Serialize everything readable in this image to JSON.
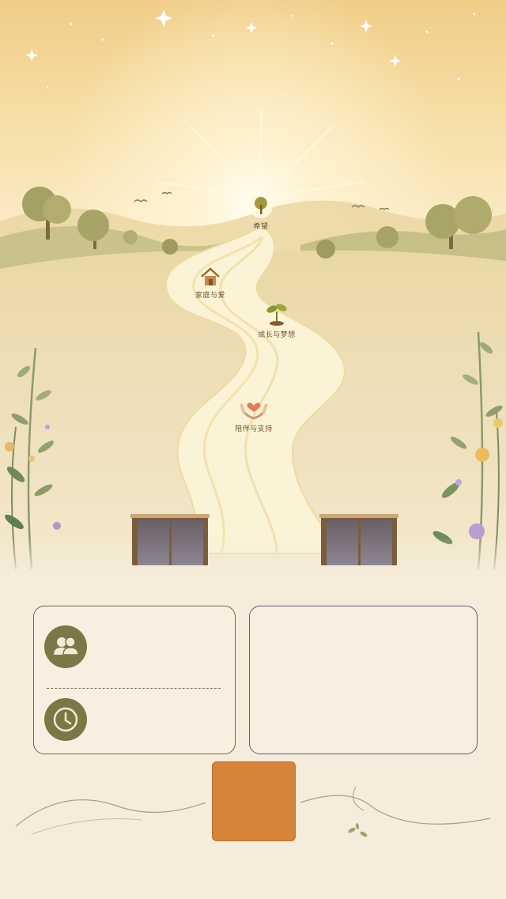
{
  "scene": {
    "milestones": [
      {
        "id": "tree",
        "icon": "tree-icon",
        "label": "希望"
      },
      {
        "id": "home",
        "icon": "house-icon",
        "label": "家庭与爱"
      },
      {
        "id": "sprout",
        "icon": "sprout-icon",
        "label": "成长与梦想"
      },
      {
        "id": "hands",
        "icon": "heart-hands-icon",
        "label": "陪伴与支持"
      }
    ]
  },
  "info_card": {
    "rows": [
      {
        "icon": "people-icon",
        "text": ""
      },
      {
        "icon": "clock-icon",
        "text": ""
      }
    ]
  },
  "detail_card": {
    "text": ""
  },
  "action_button": {
    "label": ""
  },
  "colors": {
    "sky_top": "#f3cf8a",
    "path": "#fbf3d6",
    "card_border_left": "#6f6a3f",
    "card_border_right": "#5d5a86",
    "icon_bg": "#7b7746",
    "button": "#d6843a"
  }
}
